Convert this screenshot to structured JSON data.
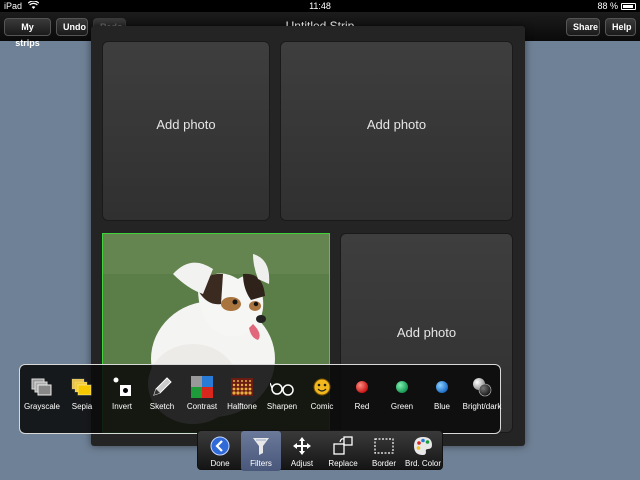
{
  "status_bar": {
    "device": "iPad",
    "time": "11:48",
    "battery": "88 %"
  },
  "nav": {
    "left_buttons": [
      "My strips",
      "Undo",
      "Redo"
    ],
    "title": "Untitled Strip",
    "right_buttons": [
      "Share",
      "Help"
    ]
  },
  "strip": {
    "panels": [
      "Add photo",
      "Add photo",
      "Add photo"
    ]
  },
  "filters": {
    "items": [
      "Grayscale",
      "Sepia",
      "Invert",
      "Sketch",
      "Contrast",
      "Halftone",
      "Sharpen",
      "Comic",
      "Red",
      "Green",
      "Blue",
      "Bright/dark"
    ]
  },
  "tabbar": {
    "items": [
      "Done",
      "Filters",
      "Adjust",
      "Replace",
      "Border",
      "Brd. Color"
    ],
    "active": "Filters"
  },
  "colors": {
    "background": "#6f8196",
    "selection_border": "#3fd43a",
    "active_tab": "#5a6a8a"
  },
  "icons": {
    "done": "back-arrow-circle-icon",
    "filters": "funnel-icon",
    "adjust": "move-arrows-icon",
    "replace": "replace-image-icon",
    "border": "dashed-frame-icon",
    "brd_color": "palette-icon"
  }
}
